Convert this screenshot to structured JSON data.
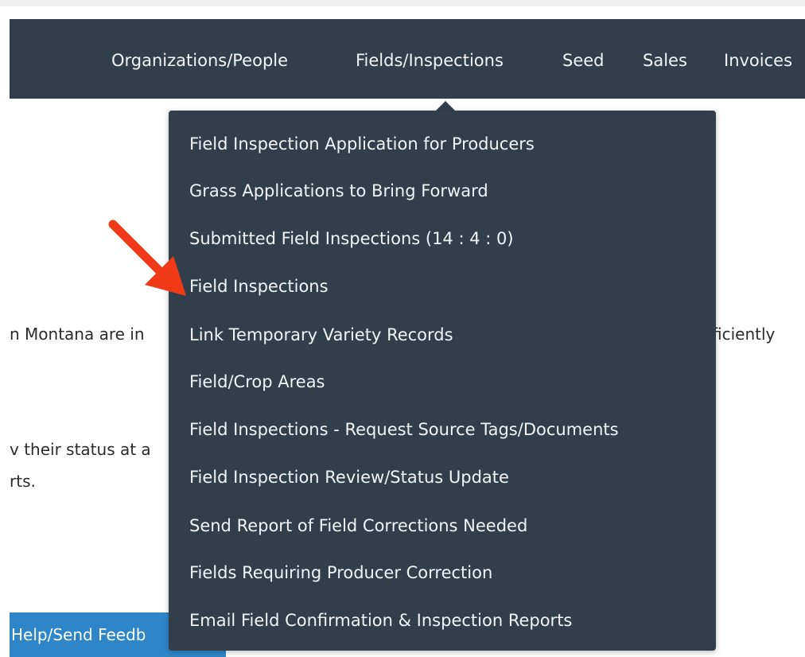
{
  "navbar": {
    "items": [
      {
        "label": "Organizations/People"
      },
      {
        "label": "Fields/Inspections"
      },
      {
        "label": "Seed"
      },
      {
        "label": "Sales"
      },
      {
        "label": "Invoices"
      }
    ]
  },
  "background_text": {
    "line1_left": "n Montana are in",
    "line1_right": "ficiently",
    "line2_left": "v their status at a",
    "line3_left": "rts."
  },
  "help_button": {
    "label": "Help/Send Feedb"
  },
  "dropdown": {
    "items": [
      {
        "label": "Field Inspection Application for Producers"
      },
      {
        "label": "Grass Applications to Bring Forward"
      },
      {
        "label": "Submitted Field Inspections (14 : 4 : 0)"
      },
      {
        "label": "Field Inspections"
      },
      {
        "label": "Link Temporary Variety Records"
      },
      {
        "label": "Field/Crop Areas"
      },
      {
        "label": "Field Inspections - Request Source Tags/Documents"
      },
      {
        "label": "Field Inspection Review/Status Update"
      },
      {
        "label": "Send Report of Field Corrections Needed"
      },
      {
        "label": "Fields Requiring Producer Correction"
      },
      {
        "label": "Email Field Confirmation & Inspection Reports"
      }
    ]
  },
  "colors": {
    "navbar_bg": "#323f4b",
    "menu_text": "#f2f4f6",
    "help_button_bg": "#2e86c9",
    "arrow": "#f03a17"
  },
  "icons": {
    "annotation": "red-arrow-icon"
  }
}
